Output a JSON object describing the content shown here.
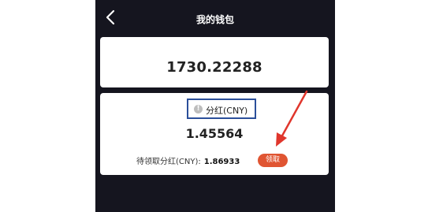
{
  "header": {
    "title": "我的钱包"
  },
  "wallet": {
    "balance": "1730.22288"
  },
  "dividend": {
    "label": "分红(CNY)",
    "value": "1.45564",
    "pending_label": "待领取分红(CNY):",
    "pending_value": "1.86933",
    "claim_button_label": "领取"
  },
  "colors": {
    "background": "#15151f",
    "claim_button": "#e05532",
    "highlight_box": "#2b4f9a",
    "annotation_arrow": "#e0362c"
  },
  "icons": {
    "back": "back-arrow-icon",
    "info": "info-icon"
  }
}
